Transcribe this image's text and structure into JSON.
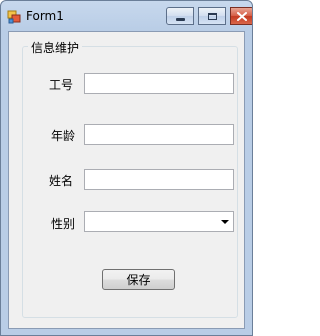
{
  "window": {
    "title": "Form1"
  },
  "group": {
    "title": "信息维护"
  },
  "fields": {
    "employee_id": {
      "label": "工号",
      "value": ""
    },
    "age": {
      "label": "年龄",
      "value": ""
    },
    "name": {
      "label": "姓名",
      "value": ""
    },
    "gender": {
      "label": "性别",
      "value": ""
    }
  },
  "actions": {
    "save_label": "保存"
  },
  "icons": {
    "app": "form-app-icon",
    "minimize": "minimize-icon",
    "maximize": "maximize-icon",
    "close": "close-icon",
    "dropdown": "chevron-down-icon"
  },
  "colors": {
    "titlebar": "#b9cde6",
    "close_button": "#c43a22",
    "client_background": "#f0f0f0"
  }
}
